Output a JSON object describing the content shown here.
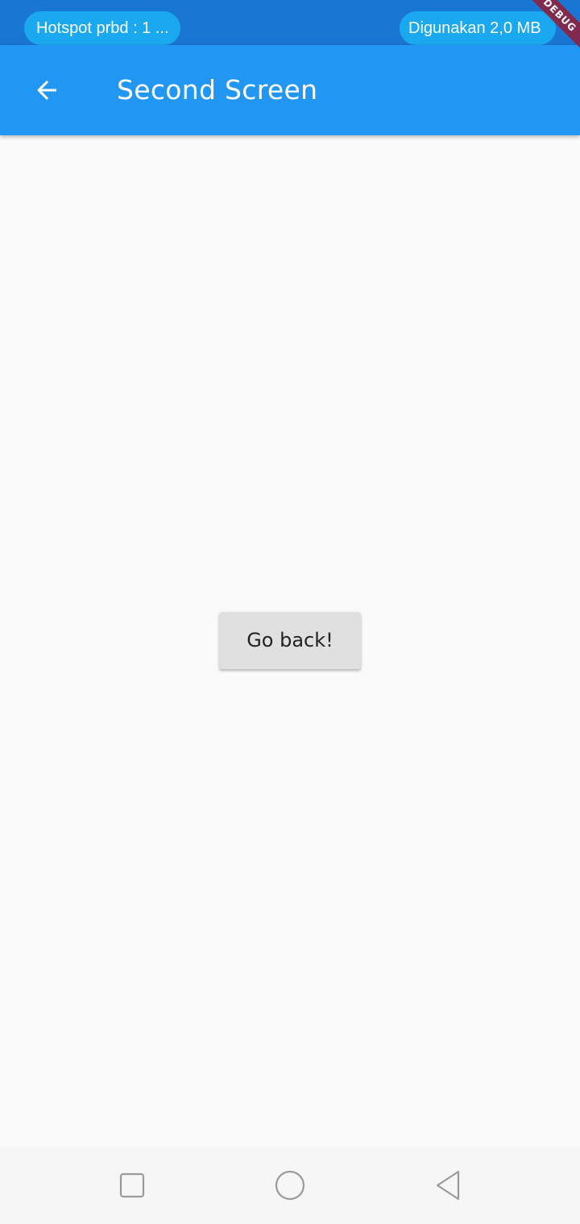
{
  "status_bar": {
    "left_pill": "Hotspot prbd : 1 ...",
    "right_pill": "Digunakan 2,0 MB"
  },
  "app_bar": {
    "title": "Second Screen",
    "back_icon": "arrow-back-icon",
    "color": "#2196f3"
  },
  "debug_banner": {
    "text": "DEBUG"
  },
  "main": {
    "go_back_label": "Go back!"
  },
  "nav_bar": {
    "recents_icon": "square-icon",
    "home_icon": "circle-icon",
    "back_icon": "triangle-back-icon"
  },
  "colors": {
    "status_bar": "#1976d2",
    "pill": "#1aa9f0",
    "background": "#fafafa",
    "button": "#e0e0e0"
  }
}
